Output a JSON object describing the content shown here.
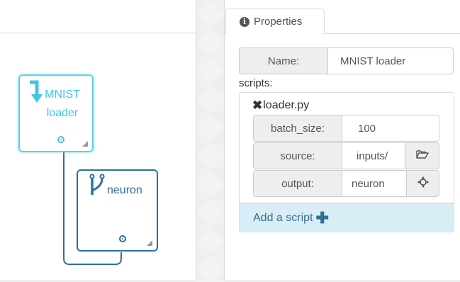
{
  "canvas": {
    "nodes": [
      {
        "title": "MNIST\nloader",
        "icon": "arrow-down-icon",
        "color": "#3ec6e6"
      },
      {
        "title": "neuron",
        "icon": "branch-icon",
        "color": "#2e6fa3"
      }
    ]
  },
  "properties": {
    "tab_label": "Properties",
    "name_label": "Name:",
    "name_value": "MNIST loader",
    "scripts_label": "scripts:",
    "script": {
      "filename": "loader.py",
      "params": [
        {
          "label": "batch_size:",
          "value": "100"
        },
        {
          "label": "source:",
          "value": "inputs/",
          "button_icon": "folder-open-icon"
        },
        {
          "label": "output:",
          "value": "neuron",
          "button_icon": "crosshairs-icon"
        }
      ]
    },
    "add_script_label": "Add a script"
  },
  "colors": {
    "selected_node": "#5bd0ea",
    "node": "#2e6fa3",
    "add_script_bg": "#d9edf7",
    "add_script_text": "#31708f"
  }
}
